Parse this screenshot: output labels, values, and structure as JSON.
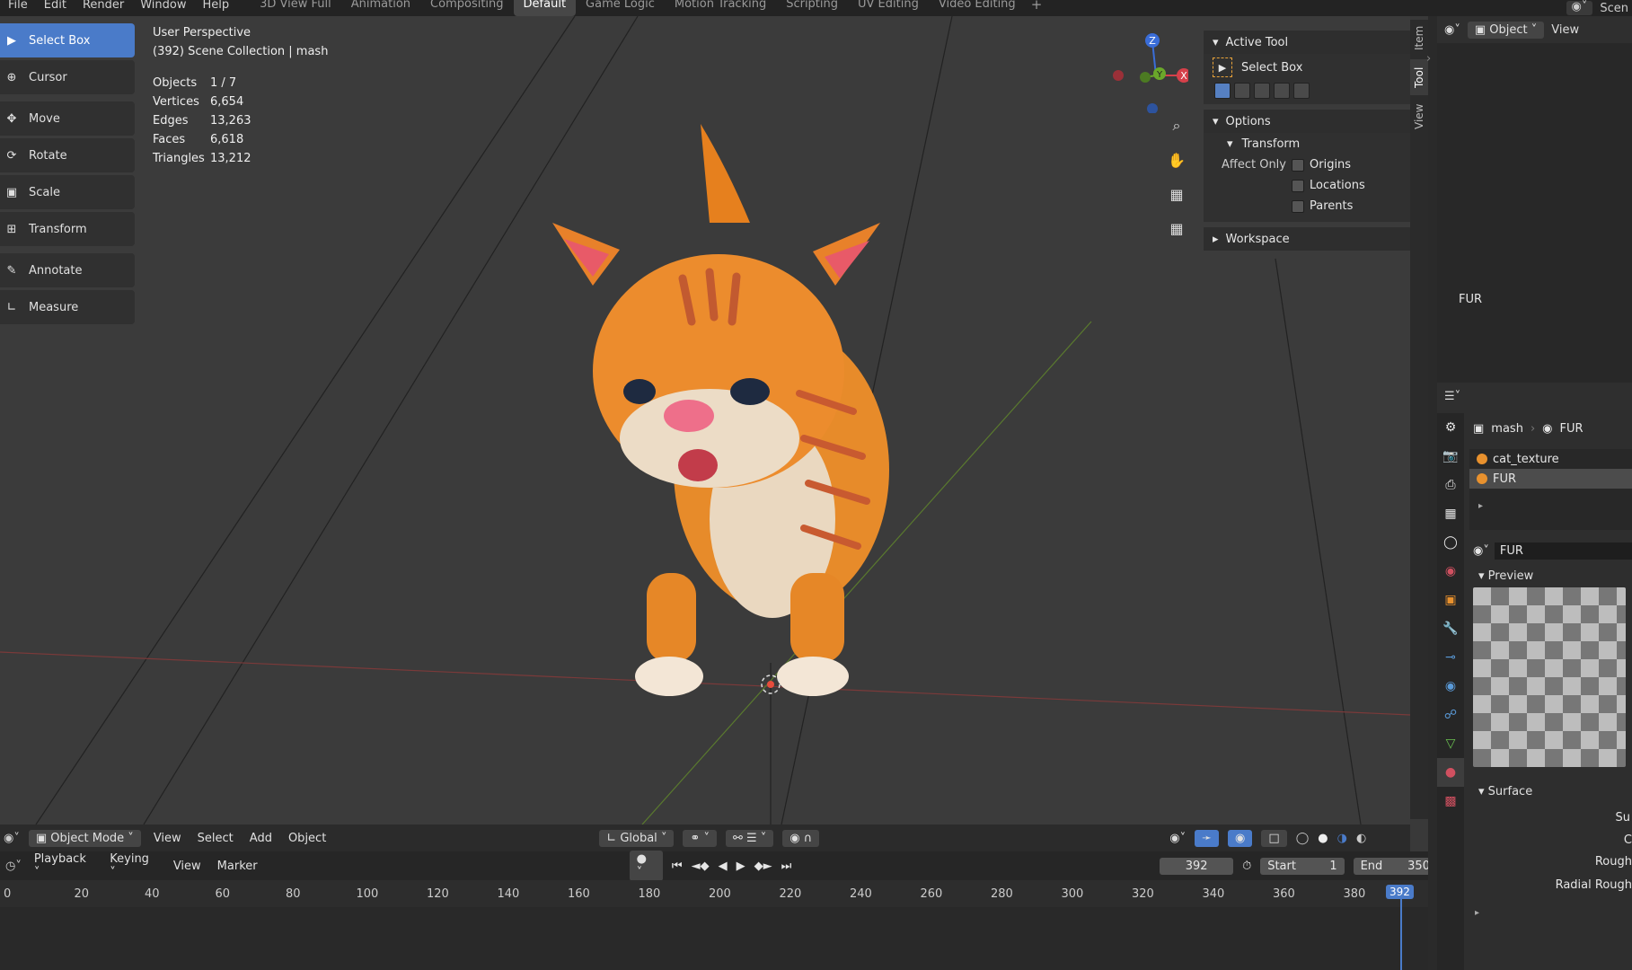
{
  "topbar": {
    "menus": [
      "File",
      "Edit",
      "Render",
      "Window",
      "Help"
    ],
    "workspaces": [
      "3D View Full",
      "Animation",
      "Compositing",
      "Default",
      "Game Logic",
      "Motion Tracking",
      "Scripting",
      "UV Editing",
      "Video Editing"
    ],
    "active_workspace": "Default",
    "add_label": "+",
    "scene_label": "Scen"
  },
  "viewport": {
    "perspective": "User Perspective",
    "collection": "(392) Scene Collection | mash",
    "stats": [
      {
        "key": "Objects",
        "value": "1 / 7"
      },
      {
        "key": "Vertices",
        "value": "6,654"
      },
      {
        "key": "Edges",
        "value": "13,263"
      },
      {
        "key": "Faces",
        "value": "6,618"
      },
      {
        "key": "Triangles",
        "value": "13,212"
      }
    ],
    "gizmo": {
      "z": "Z",
      "y": "Y",
      "x": "X"
    }
  },
  "toolbar": {
    "tools": [
      "Select Box",
      "Cursor",
      "Move",
      "Rotate",
      "Scale",
      "Transform",
      "Annotate",
      "Measure"
    ]
  },
  "npanel": {
    "active_tool_header": "Active Tool",
    "active_tool_name": "Select Box",
    "options_header": "Options",
    "transform_header": "Transform",
    "affect_only_label": "Affect Only",
    "checkboxes": [
      "Origins",
      "Locations",
      "Parents"
    ],
    "workspace_header": "Workspace",
    "tabs": [
      "Item",
      "Tool",
      "View"
    ]
  },
  "vp_header": {
    "mode": "Object Mode",
    "menus": [
      "View",
      "Select",
      "Add",
      "Object"
    ],
    "orientation": "Global"
  },
  "timeline": {
    "menus": [
      "Playback",
      "Keying",
      "View",
      "Marker"
    ],
    "current_frame": "392",
    "start_label": "Start",
    "start_value": "1",
    "end_label": "End",
    "end_value": "350",
    "ticks": [
      "0",
      "20",
      "40",
      "60",
      "80",
      "100",
      "120",
      "140",
      "160",
      "180",
      "200",
      "220",
      "240",
      "260",
      "280",
      "300",
      "320",
      "340",
      "360",
      "380"
    ],
    "cursor_label": "392"
  },
  "outliner": {
    "mode": "Object",
    "view_label": "View",
    "item": "FUR"
  },
  "properties": {
    "breadcrumb_object": "mash",
    "breadcrumb_material": "FUR",
    "slots": [
      "cat_texture",
      "FUR"
    ],
    "material_name": "FUR",
    "preview_header": "Preview",
    "surface_header": "Surface",
    "surface_field": "Su",
    "rough_label": "Rough",
    "radial_rough_label": "Radial Rough",
    "c_label": "C"
  }
}
